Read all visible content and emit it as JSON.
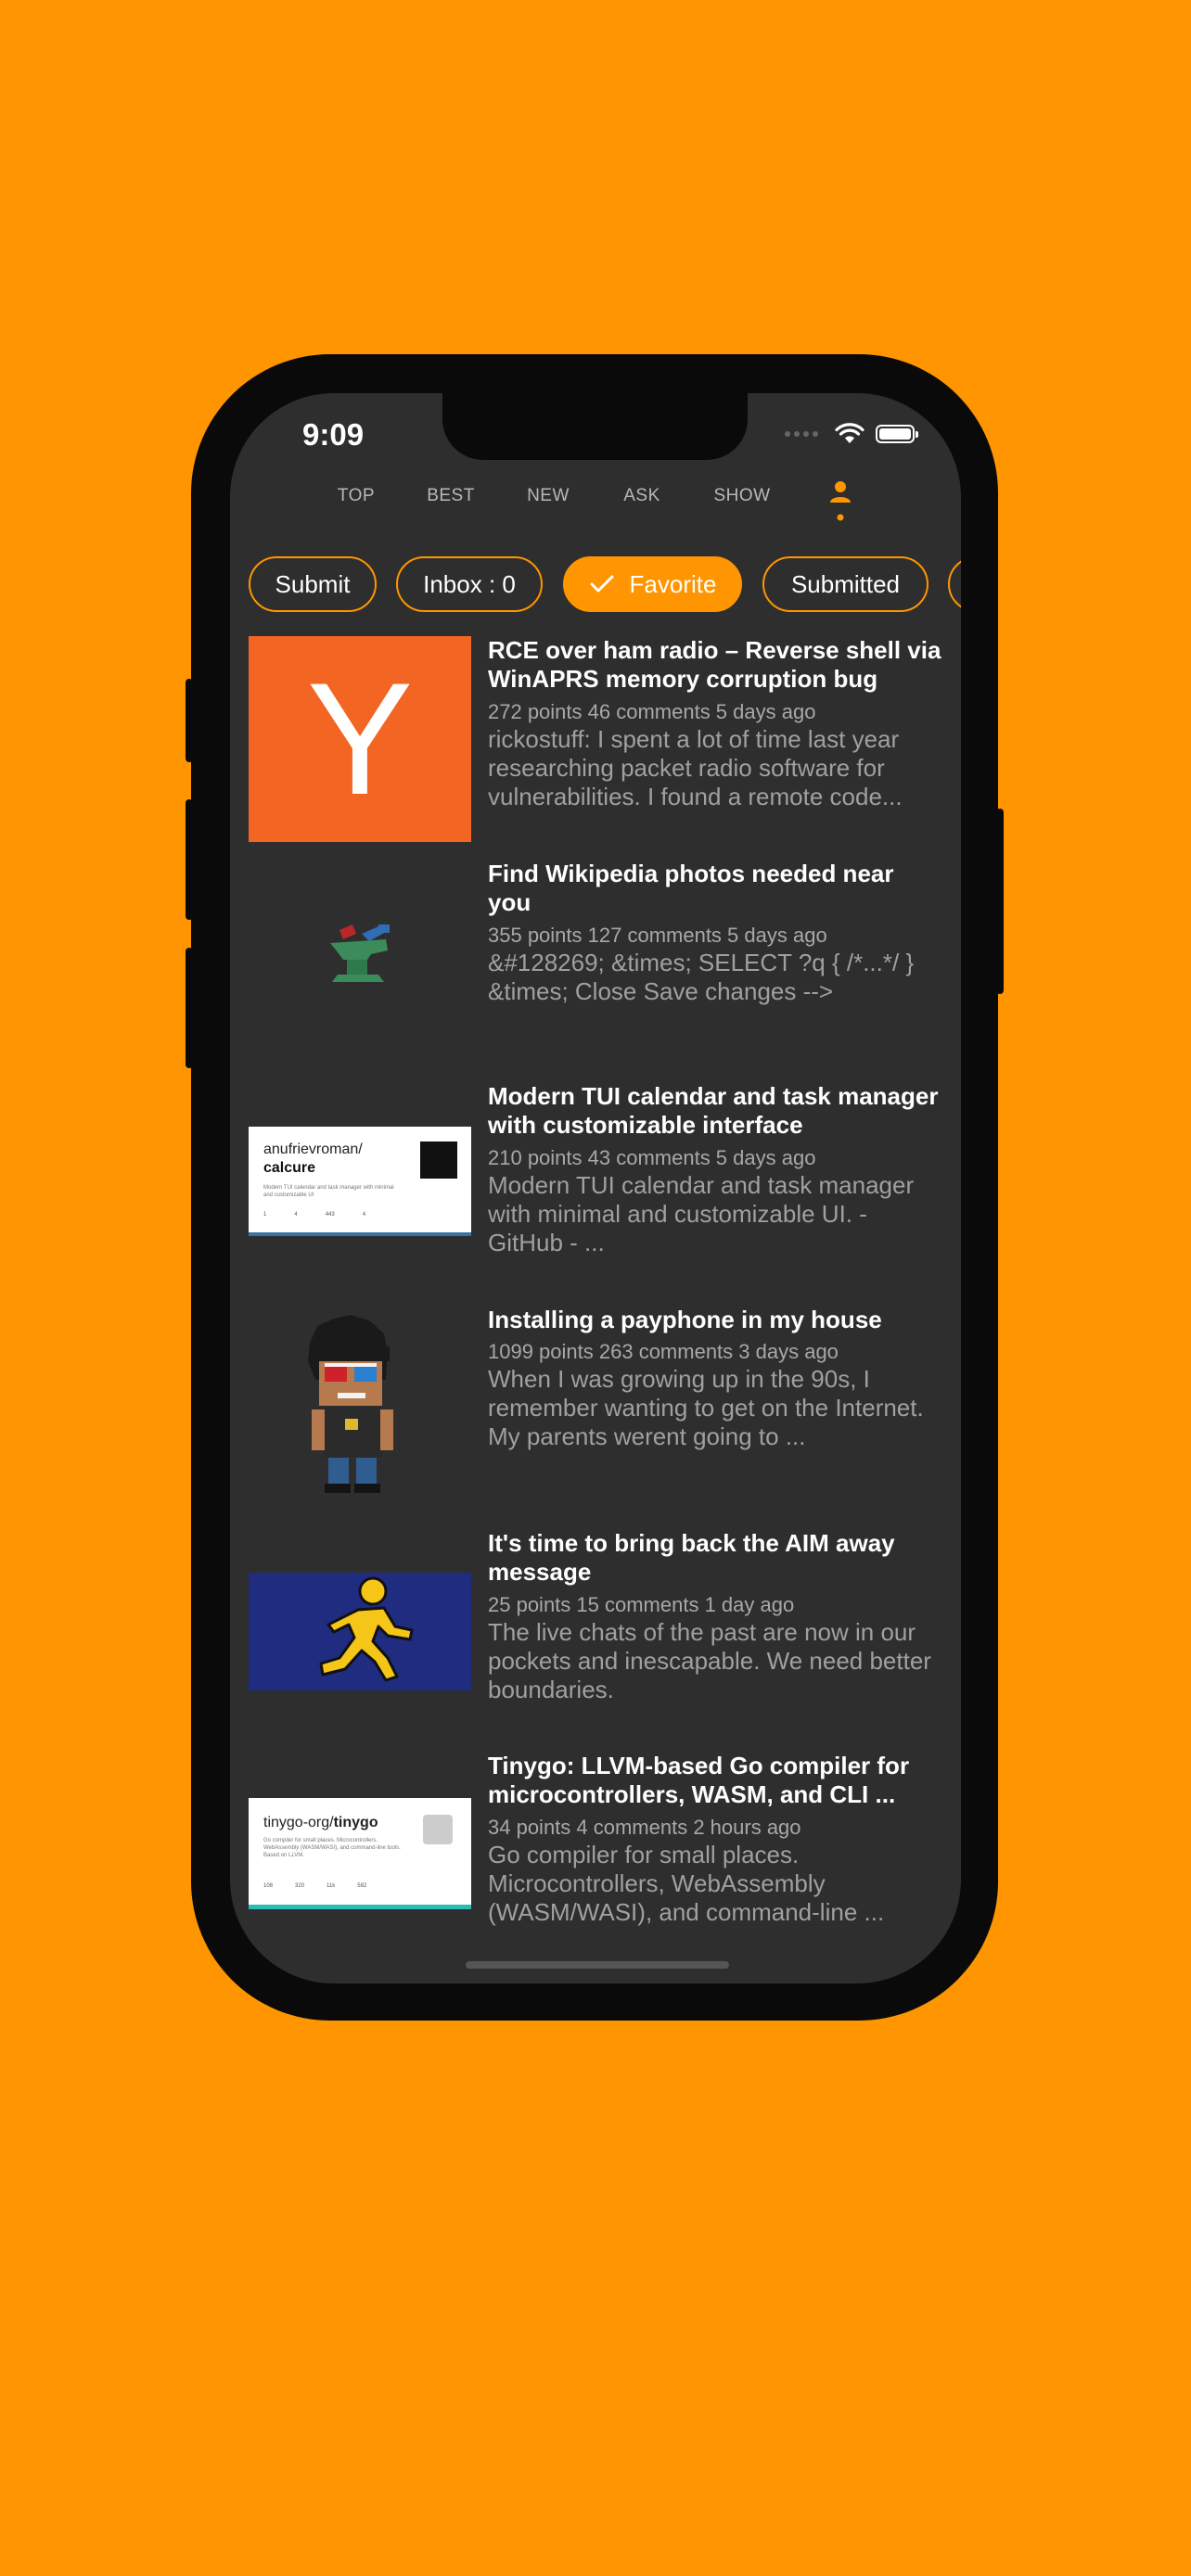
{
  "status_bar": {
    "time": "9:09"
  },
  "tabs": [
    {
      "label": "TOP"
    },
    {
      "label": "BEST"
    },
    {
      "label": "NEW"
    },
    {
      "label": "ASK"
    },
    {
      "label": "SHOW"
    }
  ],
  "chips": [
    {
      "label": "Submit"
    },
    {
      "label": "Inbox : 0"
    },
    {
      "label": "Favorite"
    },
    {
      "label": "Submitted"
    }
  ],
  "stories": [
    {
      "title": "RCE over ham radio – Reverse shell via WinAPRS memory corruption bug",
      "meta": "272 points 46 comments 5 days ago",
      "excerpt": "rickostuff: I spent a lot of time last year researching packet radio software for vulnerabilities. I found a remote code...",
      "thumb_letter": "Y"
    },
    {
      "title": "Find Wikipedia photos needed near you",
      "meta": "355 points 127 comments 5 days ago",
      "excerpt": "&#128269; &times; SELECT ?q { /*...*/ } &times; Close Save changes -->"
    },
    {
      "title": "Modern TUI calendar and task manager with customizable interface",
      "meta": "210 points 43 comments 5 days ago",
      "excerpt": "Modern TUI calendar and task manager with minimal and customizable UI. - GitHub - ...",
      "thumb_owner": "anufrievroman/",
      "thumb_repo": "calcure",
      "thumb_desc": "Modern TUI calendar and task manager with minimal and customizable UI",
      "thumb_stats": [
        "1",
        "4",
        "443",
        "4"
      ]
    },
    {
      "title": "Installing a payphone in my house",
      "meta": "1099 points 263 comments 3 days ago",
      "excerpt": "When I was growing up in the 90s, I remember wanting to get on the Internet. My parents werent going to ..."
    },
    {
      "title": "It's time to bring back the AIM away message",
      "meta": "25 points 15 comments 1 day ago",
      "excerpt": "The live chats of the past are now in our pockets and inescapable. We need better boundaries."
    },
    {
      "title": "Tinygo: LLVM-based Go compiler for microcontrollers, WASM, and CLI ...",
      "meta": "34 points 4 comments 2 hours ago",
      "excerpt": "Go compiler for small places. Microcontrollers, WebAssembly (WASM/WASI), and command-line ...",
      "thumb_owner": "tinygo-org/",
      "thumb_repo": "tinygo",
      "thumb_desc": "Go compiler for small places. Microcontrollers, WebAssembly (WASM/WASI), and command-line tools. Based on LLVM.",
      "thumb_stats": [
        "108",
        "320",
        "11k",
        "582"
      ]
    }
  ],
  "colors": {
    "accent": "#FF9500",
    "background": "#2e2e2e",
    "hn_orange": "#F26522",
    "aim_blue": "#1F2C80",
    "aim_yellow": "#F5C518"
  },
  "icons": {
    "user_tab": "person-icon",
    "chip_check": "checkmark-icon"
  }
}
